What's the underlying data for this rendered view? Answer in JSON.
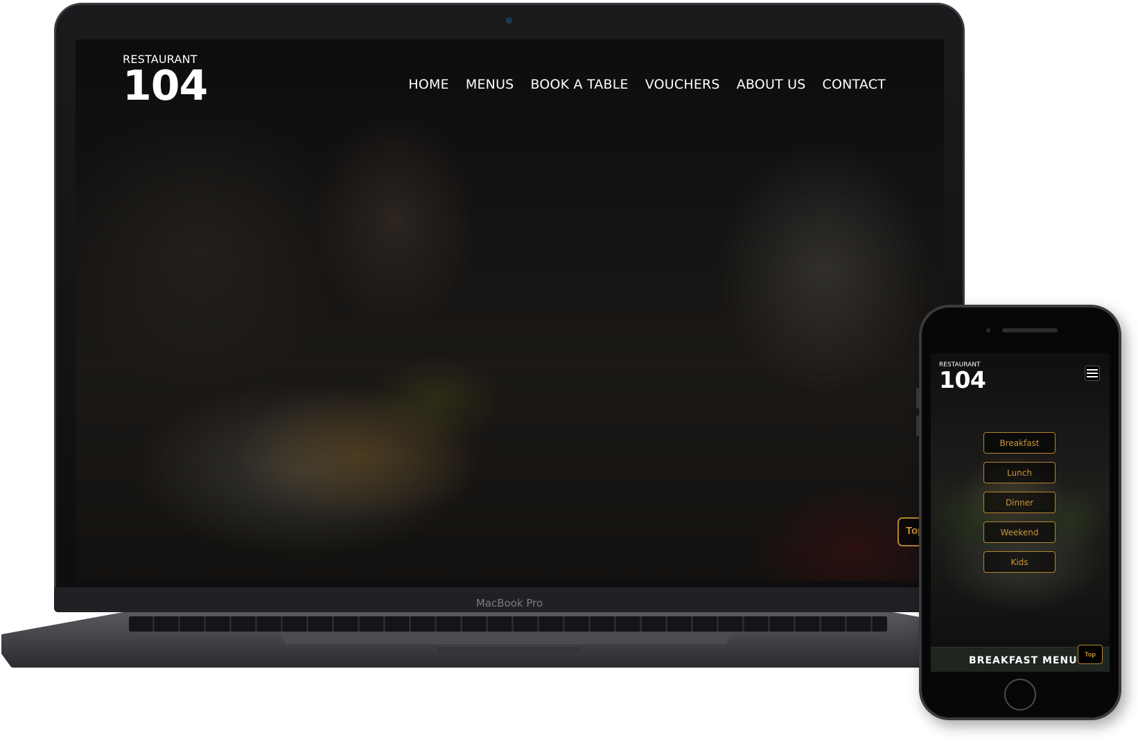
{
  "laptop": {
    "model_label": "MacBook Pro",
    "site": {
      "logo_small": "RESTAURANT",
      "logo_big": "104",
      "nav": [
        {
          "label": "HOME"
        },
        {
          "label": "MENUS"
        },
        {
          "label": "BOOK A TABLE"
        },
        {
          "label": "VOUCHERS"
        },
        {
          "label": "ABOUT US"
        },
        {
          "label": "CONTACT"
        }
      ],
      "top_button": "Top"
    }
  },
  "phone": {
    "site": {
      "logo_small": "RESTAURANT",
      "logo_big": "104",
      "menu_icon": "hamburger-icon",
      "menu_buttons": [
        {
          "label": "Breakfast"
        },
        {
          "label": "Lunch"
        },
        {
          "label": "Dinner"
        },
        {
          "label": "Weekend"
        },
        {
          "label": "Kids"
        }
      ],
      "footer_title": "BREAKFAST MENU",
      "top_button": "Top"
    }
  },
  "colors": {
    "accent_gold": "#b5862f",
    "text_white": "#ffffff",
    "footer_bg": "#1f2620"
  }
}
